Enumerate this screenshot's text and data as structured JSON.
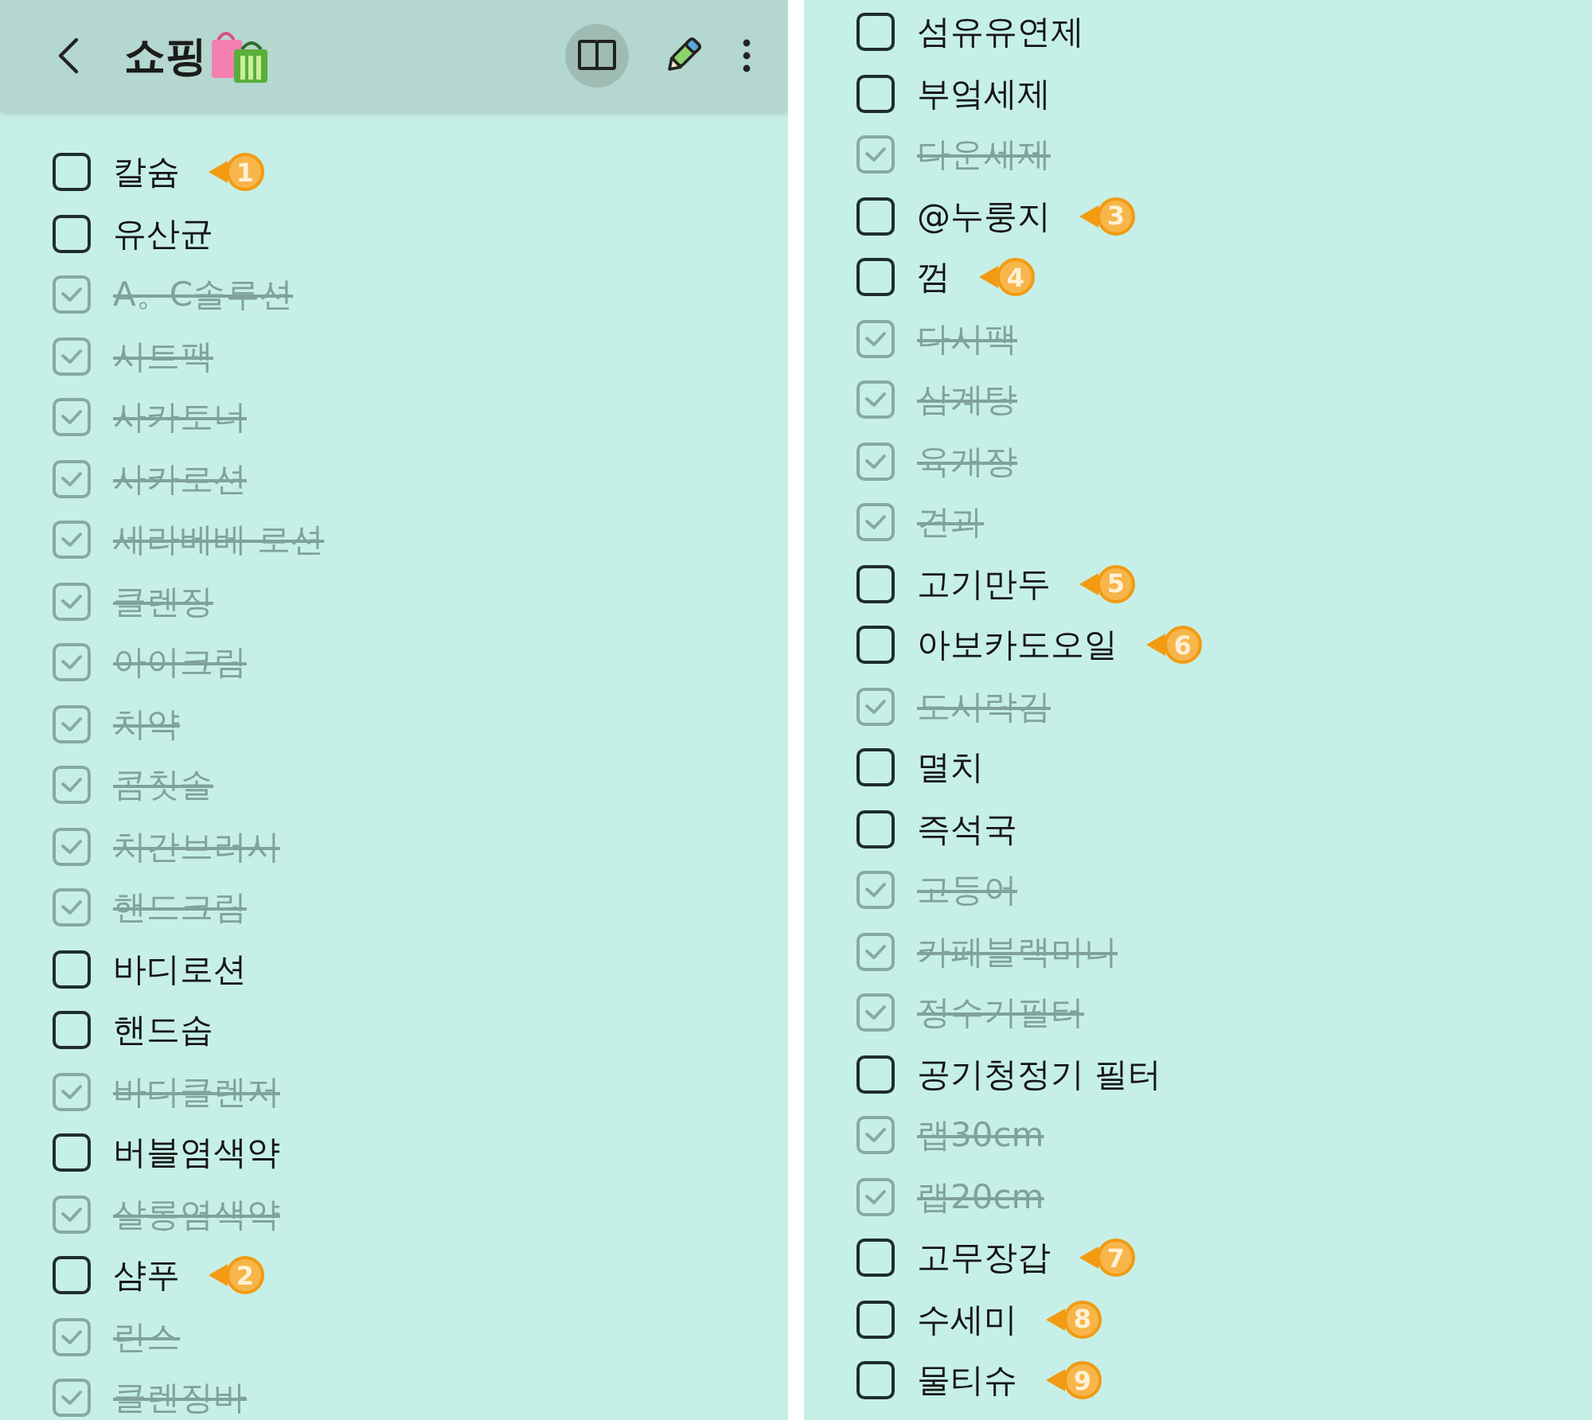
{
  "left": {
    "header": {
      "title": "쇼핑"
    },
    "items": [
      {
        "text": "칼슘",
        "checked": false,
        "marker": "1"
      },
      {
        "text": "유산균",
        "checked": false
      },
      {
        "text": "A。C솔루션",
        "checked": true
      },
      {
        "text": "시트팩",
        "checked": true
      },
      {
        "text": "사카토너",
        "checked": true
      },
      {
        "text": "사카로션",
        "checked": true
      },
      {
        "text": "세라베베 로션",
        "checked": true
      },
      {
        "text": "클렌징",
        "checked": true
      },
      {
        "text": "아이크림",
        "checked": true
      },
      {
        "text": "치약",
        "checked": true
      },
      {
        "text": "콤칫솔",
        "checked": true
      },
      {
        "text": "치간브러시",
        "checked": true
      },
      {
        "text": "핸드크림",
        "checked": true
      },
      {
        "text": "바디로션",
        "checked": false
      },
      {
        "text": "핸드솝",
        "checked": false
      },
      {
        "text": "바디클렌저",
        "checked": true
      },
      {
        "text": "버블염색약",
        "checked": false
      },
      {
        "text": "살롱염색약",
        "checked": true
      },
      {
        "text": "샴푸",
        "checked": false,
        "marker": "2"
      },
      {
        "text": "린스",
        "checked": true
      },
      {
        "text": "클렌징바",
        "checked": true
      }
    ]
  },
  "right": {
    "items": [
      {
        "text": "섬유유연제",
        "checked": false
      },
      {
        "text": "부엌세제",
        "checked": false
      },
      {
        "text": "다운세제",
        "checked": true
      },
      {
        "text": "@누룽지",
        "checked": false,
        "marker": "3"
      },
      {
        "text": "껌",
        "checked": false,
        "marker": "4"
      },
      {
        "text": "다시팩",
        "checked": true
      },
      {
        "text": "삼계탕",
        "checked": true
      },
      {
        "text": "육개장",
        "checked": true
      },
      {
        "text": "견과",
        "checked": true
      },
      {
        "text": "고기만두",
        "checked": false,
        "marker": "5"
      },
      {
        "text": "아보카도오일",
        "checked": false,
        "marker": "6"
      },
      {
        "text": "도시락김",
        "checked": true
      },
      {
        "text": "멸치",
        "checked": false
      },
      {
        "text": "즉석국",
        "checked": false
      },
      {
        "text": "고등어",
        "checked": true
      },
      {
        "text": "카페블랙미니",
        "checked": true
      },
      {
        "text": "정수기필터",
        "checked": true
      },
      {
        "text": "공기청정기 필터",
        "checked": false
      },
      {
        "text": "랩30cm",
        "checked": true
      },
      {
        "text": "랩20cm",
        "checked": true
      },
      {
        "text": "고무장갑",
        "checked": false,
        "marker": "7"
      },
      {
        "text": "수세미",
        "checked": false,
        "marker": "8"
      },
      {
        "text": "물티슈",
        "checked": false,
        "marker": "9"
      }
    ]
  }
}
